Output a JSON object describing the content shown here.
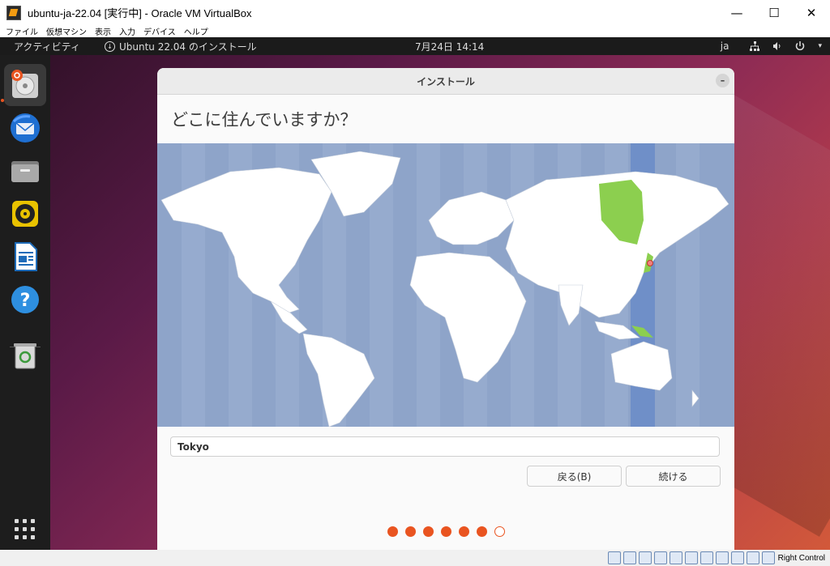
{
  "window": {
    "title": "ubuntu-ja-22.04 [実行中] - Oracle VM VirtualBox",
    "minimize": "—",
    "maximize": "☐",
    "close": "✕"
  },
  "menubar": [
    "ファイル",
    "仮想マシン",
    "表示",
    "入力",
    "デバイス",
    "ヘルプ"
  ],
  "topbar": {
    "activities": "アクティビティ",
    "app_indicator": "Ubuntu 22.04 のインストール",
    "clock": "7月24日  14:14",
    "lang": "ja"
  },
  "installer": {
    "window_title": "インストール",
    "minimize": "–",
    "question": "どこに住んでいますか？",
    "location_value": "Tokyo",
    "back_label": "戻る(B)",
    "continue_label": "続ける",
    "progress_total": 7,
    "progress_current": 6
  },
  "statusbar": {
    "host_key": "Right Control"
  },
  "colors": {
    "accent": "#e95420",
    "map_ocean": "#8ea4c9",
    "timezone_band": "#6f8fc8",
    "selected_region": "#8ccf4f"
  }
}
